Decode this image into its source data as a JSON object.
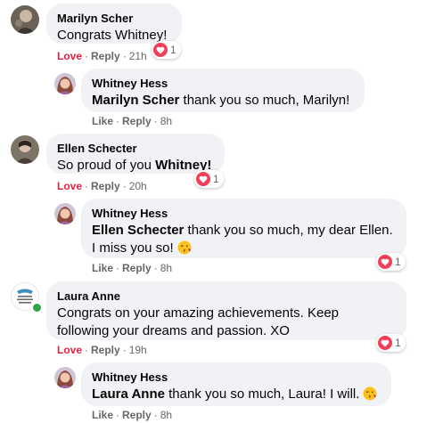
{
  "comments": [
    {
      "author": "Marilyn Scher",
      "text": "Congrats Whitney!",
      "actions": {
        "love": "Love",
        "reply": "Reply",
        "time": "21h"
      },
      "reaction_count": "1"
    },
    {
      "author": "Whitney Hess",
      "mention": "Marilyn Scher",
      "text": " thank you so much, Marilyn!",
      "actions": {
        "like": "Like",
        "reply": "Reply",
        "time": "8h"
      }
    },
    {
      "author": "Ellen Schecter",
      "text": "So proud of you ",
      "mention": "Whitney!",
      "actions": {
        "love": "Love",
        "reply": "Reply",
        "time": "20h"
      },
      "reaction_count": "1"
    },
    {
      "author": "Whitney Hess",
      "mention": "Ellen Schecter",
      "text_line1": " thank you so much, my dear Ellen.",
      "text_line2": "I miss you so!",
      "actions": {
        "like": "Like",
        "reply": "Reply",
        "time": "8h"
      },
      "reaction_count": "1"
    },
    {
      "author": "Laura Anne",
      "text_line1": "Congrats on your amazing achievements. Keep",
      "text_line2": "following your dreams and passion. XO",
      "actions": {
        "love": "Love",
        "reply": "Reply",
        "time": "19h"
      },
      "reaction_count": "1"
    },
    {
      "author": "Whitney Hess",
      "mention": "Laura Anne",
      "text": " thank you so much, Laura! I will.",
      "actions": {
        "like": "Like",
        "reply": "Reply",
        "time": "8h"
      }
    }
  ],
  "separator": "·",
  "colors": {
    "bubble": "#f0f2f5",
    "love": "#e41e3f",
    "heart": "#f33e58",
    "meta": "#65676b",
    "online": "#31a24c"
  },
  "icons": {
    "reaction": "heart-icon",
    "emoji": "kissing-face-icon"
  }
}
